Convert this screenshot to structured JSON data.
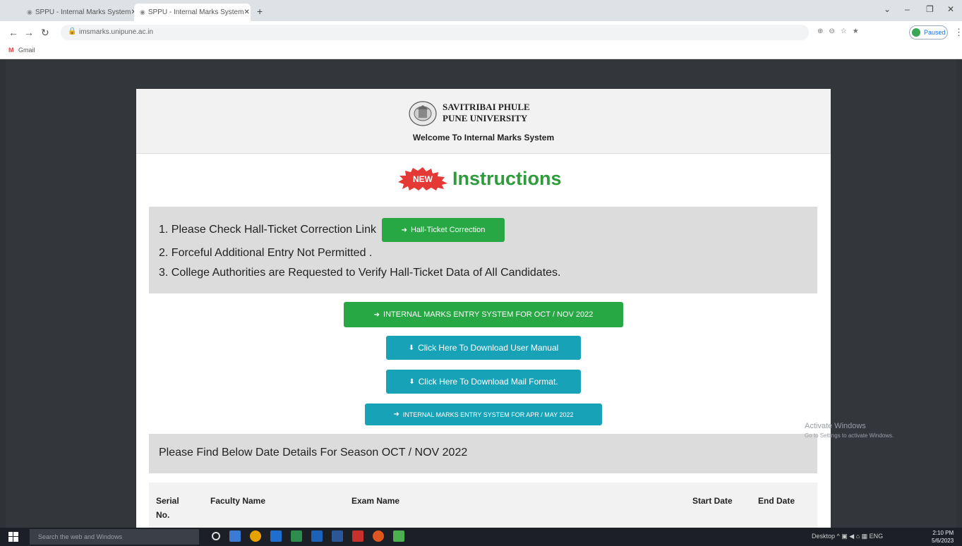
{
  "browser": {
    "tabs": [
      {
        "label": "SPPU - Internal Marks System"
      },
      {
        "label": "SPPU - Internal Marks System"
      }
    ],
    "address": "imsmarks.unipune.ac.in",
    "profile_label": "Paused",
    "bookmark": "Gmail"
  },
  "header": {
    "university_line1": "SAVITRIBAI PHULE",
    "university_line2": "PUNE UNIVERSITY",
    "welcome": "Welcome To Internal Marks System"
  },
  "instructions": {
    "badge": "NEW",
    "title": "Instructions",
    "items": [
      "1. Please Check Hall-Ticket Correction Link",
      "2. Forceful Additional Entry Not Permitted .",
      "3. College Authorities are Requested to Verify Hall-Ticket Data of All Candidates."
    ],
    "hall_ticket_button": "Hall-Ticket Correction"
  },
  "actions": {
    "oct_nov_entry": "INTERNAL MARKS ENTRY SYSTEM FOR OCT / NOV 2022",
    "user_manual": "Click Here To Download User Manual",
    "mail_format": "Click Here To Download Mail Format.",
    "apr_may_entry": "INTERNAL MARKS ENTRY SYSTEM FOR APR / MAY 2022"
  },
  "season_text": "Please Find Below Date Details For Season OCT / NOV 2022",
  "table": {
    "headers": [
      "Serial No.",
      "Faculty Name",
      "Exam Name",
      "Start Date",
      "End Date"
    ]
  },
  "watermark": {
    "line1": "Activate Windows",
    "line2": "Go to Settings to activate Windows."
  },
  "taskbar": {
    "search_placeholder": "Search the web and Windows",
    "tray_text": "Desktop",
    "lang": "ENG",
    "time": "2:10 PM",
    "date": "5/6/2023"
  },
  "colors": {
    "green": "#28a745",
    "teal": "#17a2b8",
    "title_green": "#2e9c3a",
    "badge_red": "#e53935"
  }
}
